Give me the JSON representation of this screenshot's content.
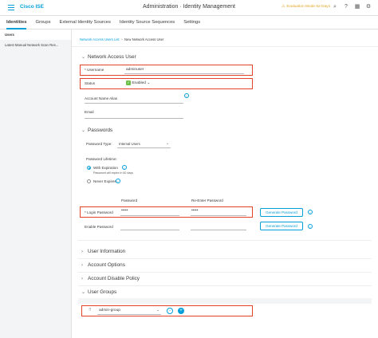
{
  "header": {
    "brand": "Cisco ISE",
    "title": "Administration · Identity Management",
    "evaluation": "Evaluation Mode 62 Days"
  },
  "tabs": [
    "Identities",
    "Groups",
    "External Identity Sources",
    "Identity Source Sequences",
    "Settings"
  ],
  "sidebar": {
    "items": [
      "Users",
      "Latest Manual Network Scan Res..."
    ]
  },
  "breadcrumb": {
    "link": "Network Access Users List",
    "separator": ">",
    "current": "New Network Access User"
  },
  "network_access_user": {
    "section_title": "Network Access User",
    "username_label": "* Username",
    "username_value": "adminuser",
    "status_label": "Status",
    "status_value": "Enabled",
    "account_name_alias_label": "Account Name Alias",
    "email_label": "Email"
  },
  "passwords": {
    "section_title": "Passwords",
    "password_type_label": "Password Type:",
    "password_type_value": "Internal Users",
    "lifetime_label": "Password Lifetime:",
    "with_expiration": "With Expiration",
    "expiry_note": "Password will expire in 60 days",
    "never_expires": "Never Expires",
    "col_password": "Password",
    "col_reenter": "Re-Enter Password",
    "login_password_label": "* Login Password",
    "login_password_value": "•••••",
    "login_reenter_value": "•••••",
    "enable_password_label": "Enable Password",
    "generate_label": "Generate Password"
  },
  "collapsed_sections": [
    "User Information",
    "Account Options",
    "Account Disable Policy"
  ],
  "user_groups": {
    "section_title": "User Groups",
    "group_value": "admin-group"
  },
  "colors": {
    "accent": "#049fd9",
    "highlight": "#e6412b",
    "enabled": "#6cc04a",
    "warning": "#e2a522"
  }
}
